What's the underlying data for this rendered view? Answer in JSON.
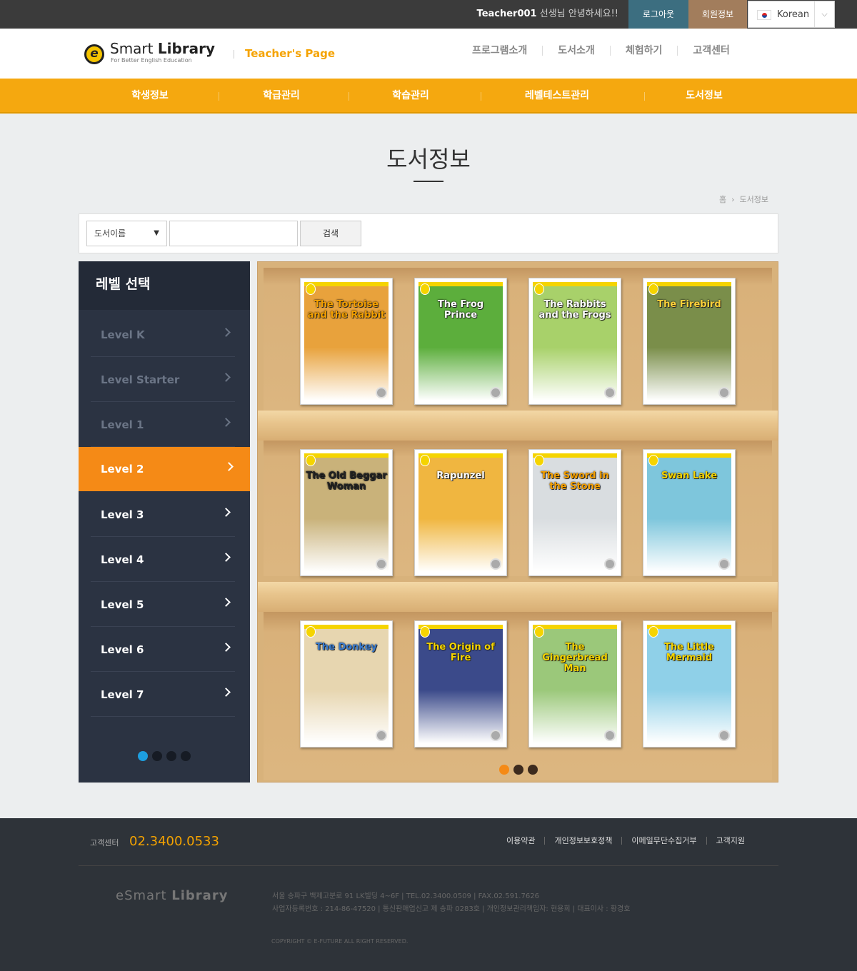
{
  "topbar": {
    "user": "Teacher001",
    "greeting_suffix": "선생님 안녕하세요!!",
    "logout": "로그아웃",
    "member_info": "회원정보",
    "language": "Korean"
  },
  "header": {
    "logo_title_a": "Smart",
    "logo_title_b": "Library",
    "logo_sub": "For Better English Education",
    "page_label": "Teacher's Page",
    "nav": [
      "프로그램소개",
      "도서소개",
      "체험하기",
      "고객센터"
    ]
  },
  "main_nav": [
    "학생정보",
    "학급관리",
    "학습관리",
    "레벨테스트관리",
    "도서정보"
  ],
  "page": {
    "title": "도서정보",
    "breadcrumb_home": "홈",
    "breadcrumb_current": "도서정보"
  },
  "search": {
    "select_value": "도서이름",
    "input_value": "",
    "button": "검색"
  },
  "sidebar": {
    "title": "레벨 선택",
    "levels": [
      "Level K",
      "Level Starter",
      "Level 1",
      "Level 2",
      "Level 3",
      "Level 4",
      "Level 5",
      "Level 6",
      "Level 7"
    ],
    "active": "Level 2",
    "pages": 4,
    "current_page": 1
  },
  "books": [
    {
      "title": "The Tortoise and the Rabbit",
      "color": "#e8a23c",
      "text": "#f5a000"
    },
    {
      "title": "The Frog Prince",
      "color": "#5cae3c",
      "text": "#ffffff"
    },
    {
      "title": "The Rabbits and the Frogs",
      "color": "#a8d16a",
      "text": "#ffffff"
    },
    {
      "title": "The Firebird",
      "color": "#7a8e4a",
      "text": "#ffd23a"
    },
    {
      "title": "The Old Beggar Woman",
      "color": "#c9b27a",
      "text": "#222222"
    },
    {
      "title": "Rapunzel",
      "color": "#f0b640",
      "text": "#ffffff"
    },
    {
      "title": "The Sword in the Stone",
      "color": "#d9dde0",
      "text": "#f5a000"
    },
    {
      "title": "Swan Lake",
      "color": "#7ec6dc",
      "text": "#f5d400"
    },
    {
      "title": "The Donkey",
      "color": "#e7d6b0",
      "text": "#3a7ccf"
    },
    {
      "title": "The Origin of Fire",
      "color": "#3b4a8a",
      "text": "#f5d400"
    },
    {
      "title": "The Gingerbread Man",
      "color": "#9bc87a",
      "text": "#f5d400"
    },
    {
      "title": "The Little Mermaid",
      "color": "#8fd0e8",
      "text": "#f5d400"
    }
  ],
  "shelf": {
    "pages": 3,
    "current_page": 1
  },
  "footer": {
    "cs_label": "고객센터",
    "cs_number": "02.3400.0533",
    "links": [
      "이용약관",
      "개인정보보호정책",
      "이메일무단수집거부",
      "고객지원"
    ],
    "logo_a": "eSmart",
    "logo_b": "Library",
    "address": "서울 송파구 백제고분로 91 LK빌딩 4~6F   |   TEL.02.3400.0509   |   FAX.02.591.7626",
    "business": "사업자등록번호 : 214-86-47520   |   통신판매업신고 제 송파 0283호   |   개인정보관리책임자: 현용희   |   대표이사 : 황경호",
    "copyright": "COPYRIGHT © E-FUTURE ALL RIGHT RESERVED."
  },
  "colors": {
    "accent": "#f5a80f",
    "active": "#f58a16",
    "sidebar": "#2b3342",
    "teal": "#3c6e80",
    "brown": "#a27d5c"
  }
}
